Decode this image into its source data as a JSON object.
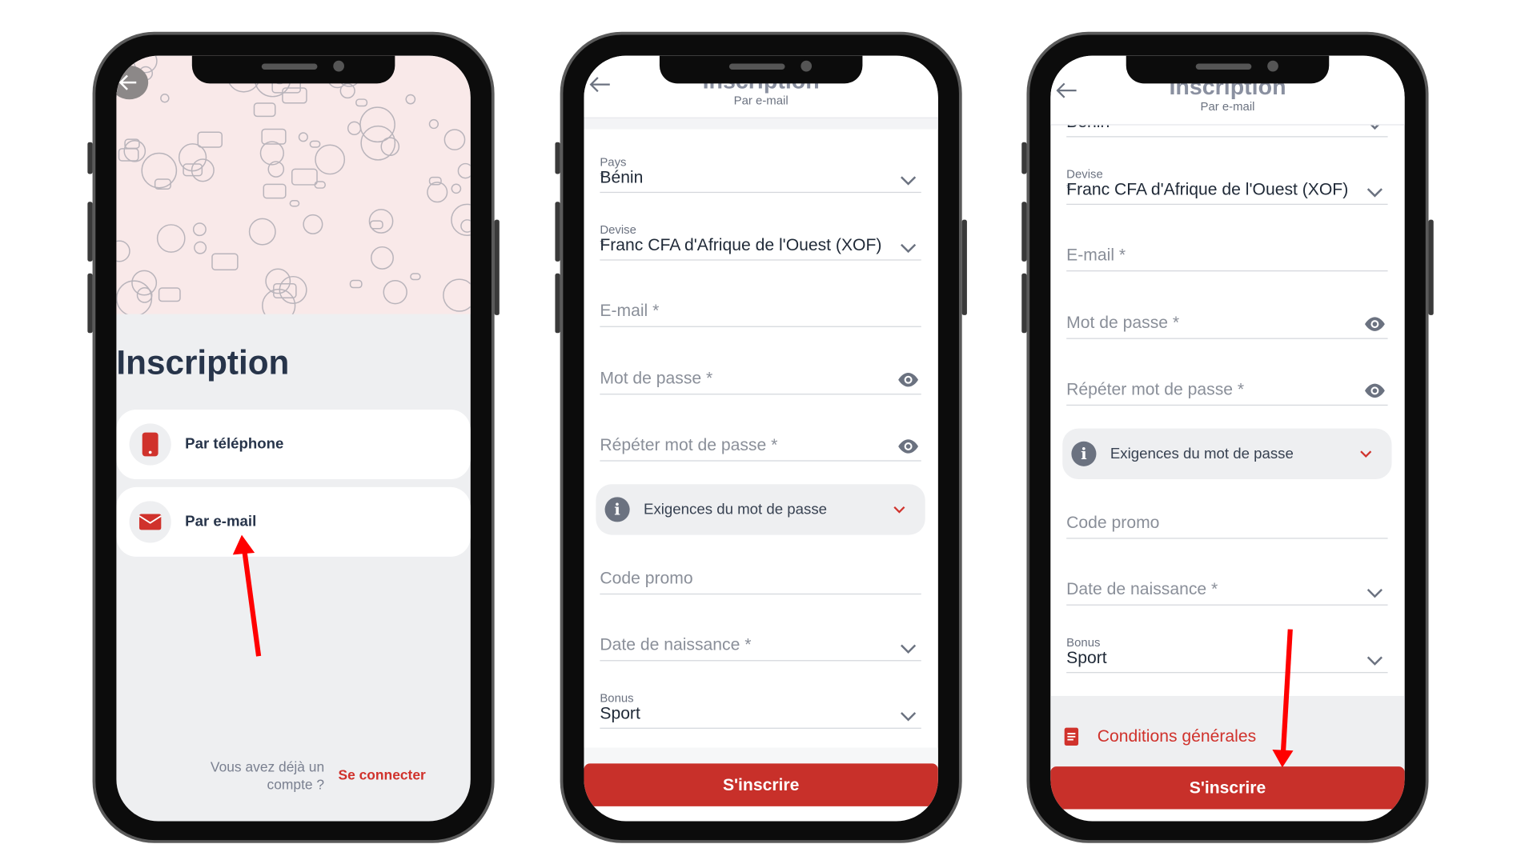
{
  "colors": {
    "accent_red": "#c8302a",
    "title_navy": "#27344a",
    "background_grey": "#eeeff1",
    "pattern_pink": "#f9e9e9"
  },
  "screen1": {
    "title": "Inscription",
    "back_icon": "arrow-left-icon",
    "options": [
      {
        "label": "Par téléphone",
        "icon": "phone-icon"
      },
      {
        "label": "Par e-mail",
        "icon": "mail-icon"
      }
    ],
    "footer_question_line1": "Vous avez déjà un",
    "footer_question_line2": "compte ?",
    "login_link": "Se connecter"
  },
  "form": {
    "header_title": "Inscription",
    "header_subtitle": "Par e-mail",
    "country": {
      "label": "Pays *",
      "value": "Bénin"
    },
    "currency": {
      "label": "Devise *",
      "value": "Franc CFA d'Afrique de l'Ouest (XOF)"
    },
    "email": {
      "placeholder": "E-mail *"
    },
    "password": {
      "placeholder": "Mot de passe *"
    },
    "password_repeat": {
      "placeholder": "Répéter mot de passe *"
    },
    "password_requirements": {
      "label": "Exigences du mot de passe"
    },
    "promo": {
      "placeholder": "Code promo"
    },
    "birthdate": {
      "placeholder": "Date de naissance *"
    },
    "bonus": {
      "label": "Bonus",
      "value": "Sport"
    },
    "terms_label": "Conditions générales",
    "submit_label": "S'inscrire"
  }
}
